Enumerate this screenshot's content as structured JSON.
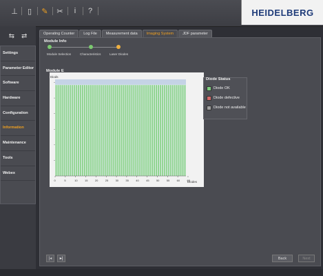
{
  "logo": "HEIDELBERG",
  "toolbar": {
    "icons": [
      "tower-icon",
      "device-icon",
      "wrench-icon",
      "tools-icon",
      "info-icon",
      "help-icon"
    ]
  },
  "sidebar": {
    "items": [
      {
        "label": "Settings"
      },
      {
        "label": "Parameter Editor"
      },
      {
        "label": "Software"
      },
      {
        "label": "Hardware"
      },
      {
        "label": "Configuration"
      },
      {
        "label": "Information"
      },
      {
        "label": "Maintenance"
      },
      {
        "label": "Tools"
      },
      {
        "label": "Webex"
      }
    ],
    "active": "Information"
  },
  "tabs": [
    {
      "label": "Operating Counter"
    },
    {
      "label": "Log File"
    },
    {
      "label": "Measurement data"
    },
    {
      "label": "Imaging System"
    },
    {
      "label": "JDF parameter"
    }
  ],
  "active_tab": "Imaging System",
  "module_info": {
    "title": "Module Info",
    "steps": [
      {
        "label": "Module Selection",
        "color": "#7bc96f"
      },
      {
        "label": "Characteristics",
        "color": "#7bc96f"
      },
      {
        "label": "Laser Diodes",
        "color": "#f0b040"
      }
    ]
  },
  "module_title": "Module E",
  "chart_data": {
    "type": "bar",
    "ylabel": "Diods",
    "xlabel": "Diodes",
    "x_ticks": [
      "0",
      "5",
      "10",
      "15",
      "20",
      "25",
      "30",
      "35",
      "40",
      "45",
      "50",
      "55",
      "60",
      "65"
    ],
    "bar_count": 64,
    "values": [
      1,
      1,
      1,
      1,
      1,
      1,
      1,
      1,
      1,
      1,
      1,
      1,
      1,
      1,
      1,
      1,
      1,
      1,
      1,
      1,
      1,
      1,
      1,
      1,
      1,
      1,
      1,
      1,
      1,
      1,
      1,
      1,
      1,
      1,
      1,
      1,
      1,
      1,
      1,
      1,
      1,
      1,
      1,
      1,
      1,
      1,
      1,
      1,
      1,
      1,
      1,
      1,
      1,
      1,
      1,
      1,
      1,
      1,
      1,
      1,
      1,
      1,
      1,
      1
    ],
    "status": "ok",
    "colors": {
      "ok": "#8fd48f",
      "background": "#c5d3e6",
      "plot": "#f2f2f2"
    }
  },
  "diode_status": {
    "title": "Diode Status",
    "items": [
      {
        "label": "Diode OK",
        "color": "#7fcf7f"
      },
      {
        "label": "Diode defective",
        "color": "#d46a6a"
      },
      {
        "label": "Diode not available",
        "color": "#a0a0a0"
      }
    ]
  },
  "buttons": {
    "back": "Back",
    "next": "Next"
  }
}
